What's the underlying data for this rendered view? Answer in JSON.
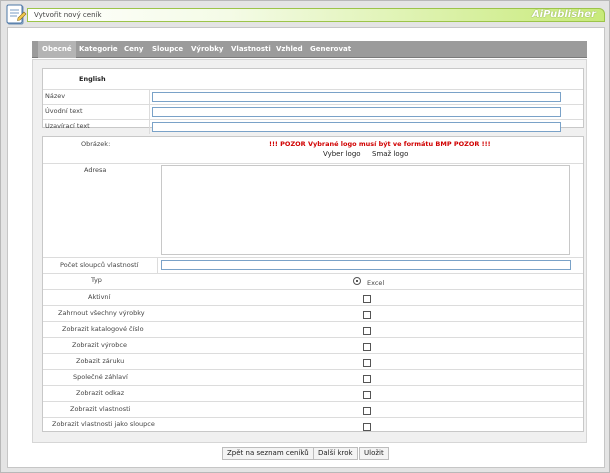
{
  "window": {
    "title": "Vytvořit nový ceník",
    "brand": "AiPublisher"
  },
  "tabs": [
    {
      "label": "Obecné",
      "active": true
    },
    {
      "label": "Kategorie"
    },
    {
      "label": "Ceny"
    },
    {
      "label": "Sloupce"
    },
    {
      "label": "Výrobky"
    },
    {
      "label": "Vlastnosti"
    },
    {
      "label": "Vzhled"
    },
    {
      "label": "Generovat"
    }
  ],
  "language_block": {
    "language": "English",
    "fields": [
      {
        "label": "Název",
        "value": ""
      },
      {
        "label": "Úvodní text",
        "value": ""
      },
      {
        "label": "Uzavírací text",
        "value": ""
      }
    ]
  },
  "settings": {
    "image_label": "Obrázek:",
    "image_warning": "!!! POZOR Vybrané logo musí být ve formátu BMP POZOR !!!",
    "choose_logo": "Vyber logo",
    "delete_logo": "Smaž logo",
    "address_label": "Adresa",
    "address_value": "",
    "columns_label": "Počet sloupců vlastností",
    "columns_value": "",
    "type_label": "Typ",
    "type_option": "Excel",
    "checkboxes": [
      {
        "label": "Aktivní",
        "checked": false
      },
      {
        "label": "Zahrnout všechny výrobky",
        "checked": false
      },
      {
        "label": "Zobrazit katalogové číslo",
        "checked": false
      },
      {
        "label": "Zobrazit výrobce",
        "checked": false
      },
      {
        "label": "Zobazit záruku",
        "checked": false
      },
      {
        "label": "Společné záhlaví",
        "checked": false
      },
      {
        "label": "Zobrazit odkaz",
        "checked": false
      },
      {
        "label": "Zobrazit vlastnosti",
        "checked": false
      },
      {
        "label": "Zobrazit vlastnosti jako sloupce",
        "checked": false
      }
    ]
  },
  "footer": {
    "back": "Zpět na seznam ceníků",
    "next": "Další krok",
    "save": "Uložit"
  },
  "colors": {
    "warning": "#d00000",
    "titlebar_accent": "#c8ea7a",
    "tab_bar": "#9b9b9b"
  }
}
